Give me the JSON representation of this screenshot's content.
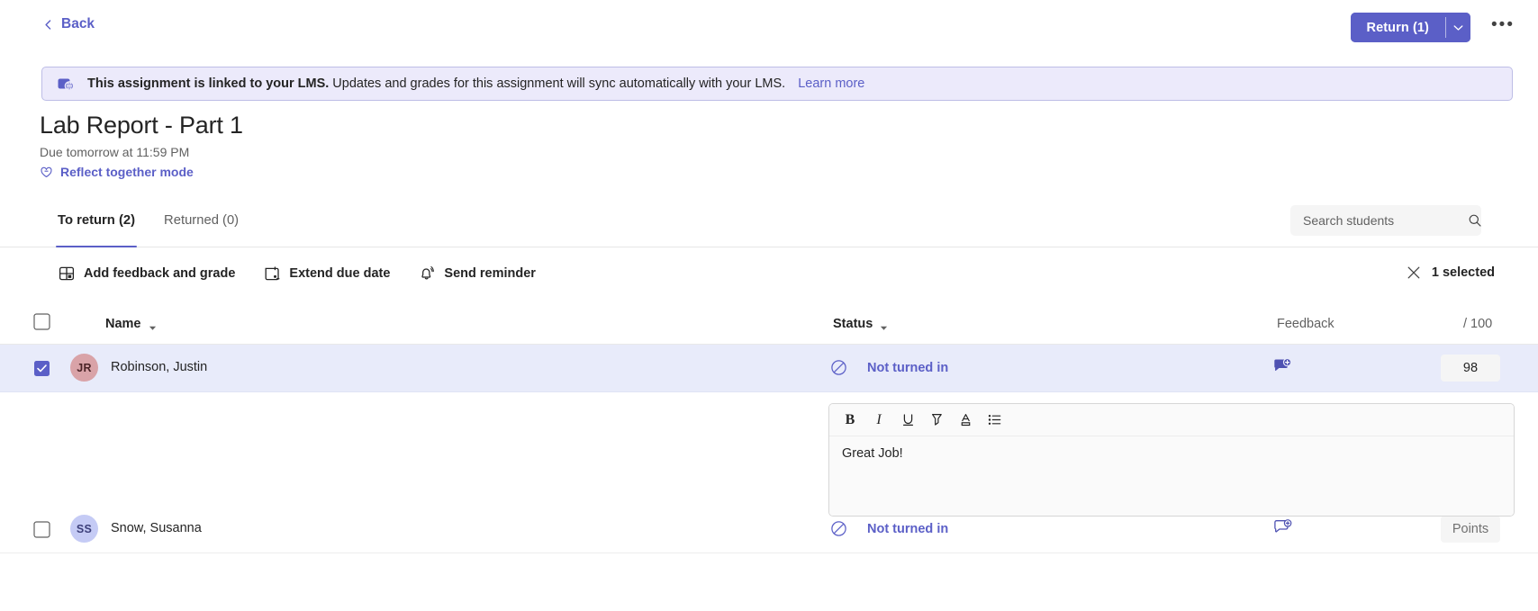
{
  "topbar": {
    "back_label": "Back",
    "back_icon": "chevron-left-icon",
    "return_label": "Return (1)",
    "return_caret_icon": "chevron-down-icon",
    "more_label": "•••",
    "accent_color": "#5b5fc7"
  },
  "banner": {
    "icon": "lms-link-icon",
    "strong_text": "This assignment is linked to your LMS.",
    "rest_text": "Updates and grades for this assignment will sync automatically with your LMS.",
    "link_text": "Learn more",
    "bg_color": "#eceafb",
    "border_color": "#bdbde6"
  },
  "title_block": {
    "title": "Lab Report - Part 1",
    "due": "Due tomorrow at 11:59 PM",
    "reflect_icon": "heart-outline-icon",
    "reflect_label": "Reflect together mode"
  },
  "tabs": [
    {
      "label": "To return (2)",
      "active": true,
      "name": "tab-to-return"
    },
    {
      "label": "Returned (0)",
      "active": false,
      "name": "tab-returned"
    }
  ],
  "search": {
    "placeholder": "Search students",
    "value": "",
    "icon": "search-icon"
  },
  "toolbar": {
    "actions": [
      {
        "label": "Add feedback and grade",
        "icon": "add-feedback-grade-icon",
        "name": "add-feedback-and-grade-button"
      },
      {
        "label": "Extend due date",
        "icon": "calendar-extend-icon",
        "name": "extend-due-date-button"
      },
      {
        "label": "Send reminder",
        "icon": "bell-icon",
        "name": "send-reminder-button"
      }
    ],
    "selected_label": "1 selected",
    "close_icon": "close-icon"
  },
  "table": {
    "headers": {
      "name": "Name",
      "status": "Status",
      "feedback": "Feedback",
      "points": "/ 100"
    },
    "sort_icon": "sort-caret-down-icon",
    "rows": [
      {
        "name": "Robinson, Justin",
        "initials": "JR",
        "avatar_color": "#d9a3a8",
        "avatar_text_color": "#4a2326",
        "checked": true,
        "status": "Not turned in",
        "status_icon": "not-turned-in-icon",
        "feedback_icon": "feedback-added-icon",
        "points_value": "98",
        "points_placeholder": "Points",
        "expanded": true
      },
      {
        "name": "Snow, Susanna",
        "initials": "SS",
        "avatar_color": "#c5cbf5",
        "avatar_text_color": "#3c3f7a",
        "checked": false,
        "status": "Not turned in",
        "status_icon": "not-turned-in-icon",
        "feedback_icon": "feedback-add-icon",
        "points_value": "",
        "points_placeholder": "Points",
        "expanded": false
      }
    ]
  },
  "feedback_editor": {
    "buttons": [
      {
        "label": "B",
        "icon": "bold-icon",
        "name": "bold-button"
      },
      {
        "label": "I",
        "icon": "italic-icon",
        "name": "italic-button"
      },
      {
        "label": "U",
        "icon": "underline-icon",
        "name": "underline-button"
      },
      {
        "label": "",
        "icon": "highlighter-icon",
        "name": "highlight-button"
      },
      {
        "label": "",
        "icon": "font-color-icon",
        "name": "font-color-button"
      },
      {
        "label": "",
        "icon": "bulleted-list-icon",
        "name": "bulleted-list-button"
      }
    ],
    "text": "Great Job!"
  }
}
